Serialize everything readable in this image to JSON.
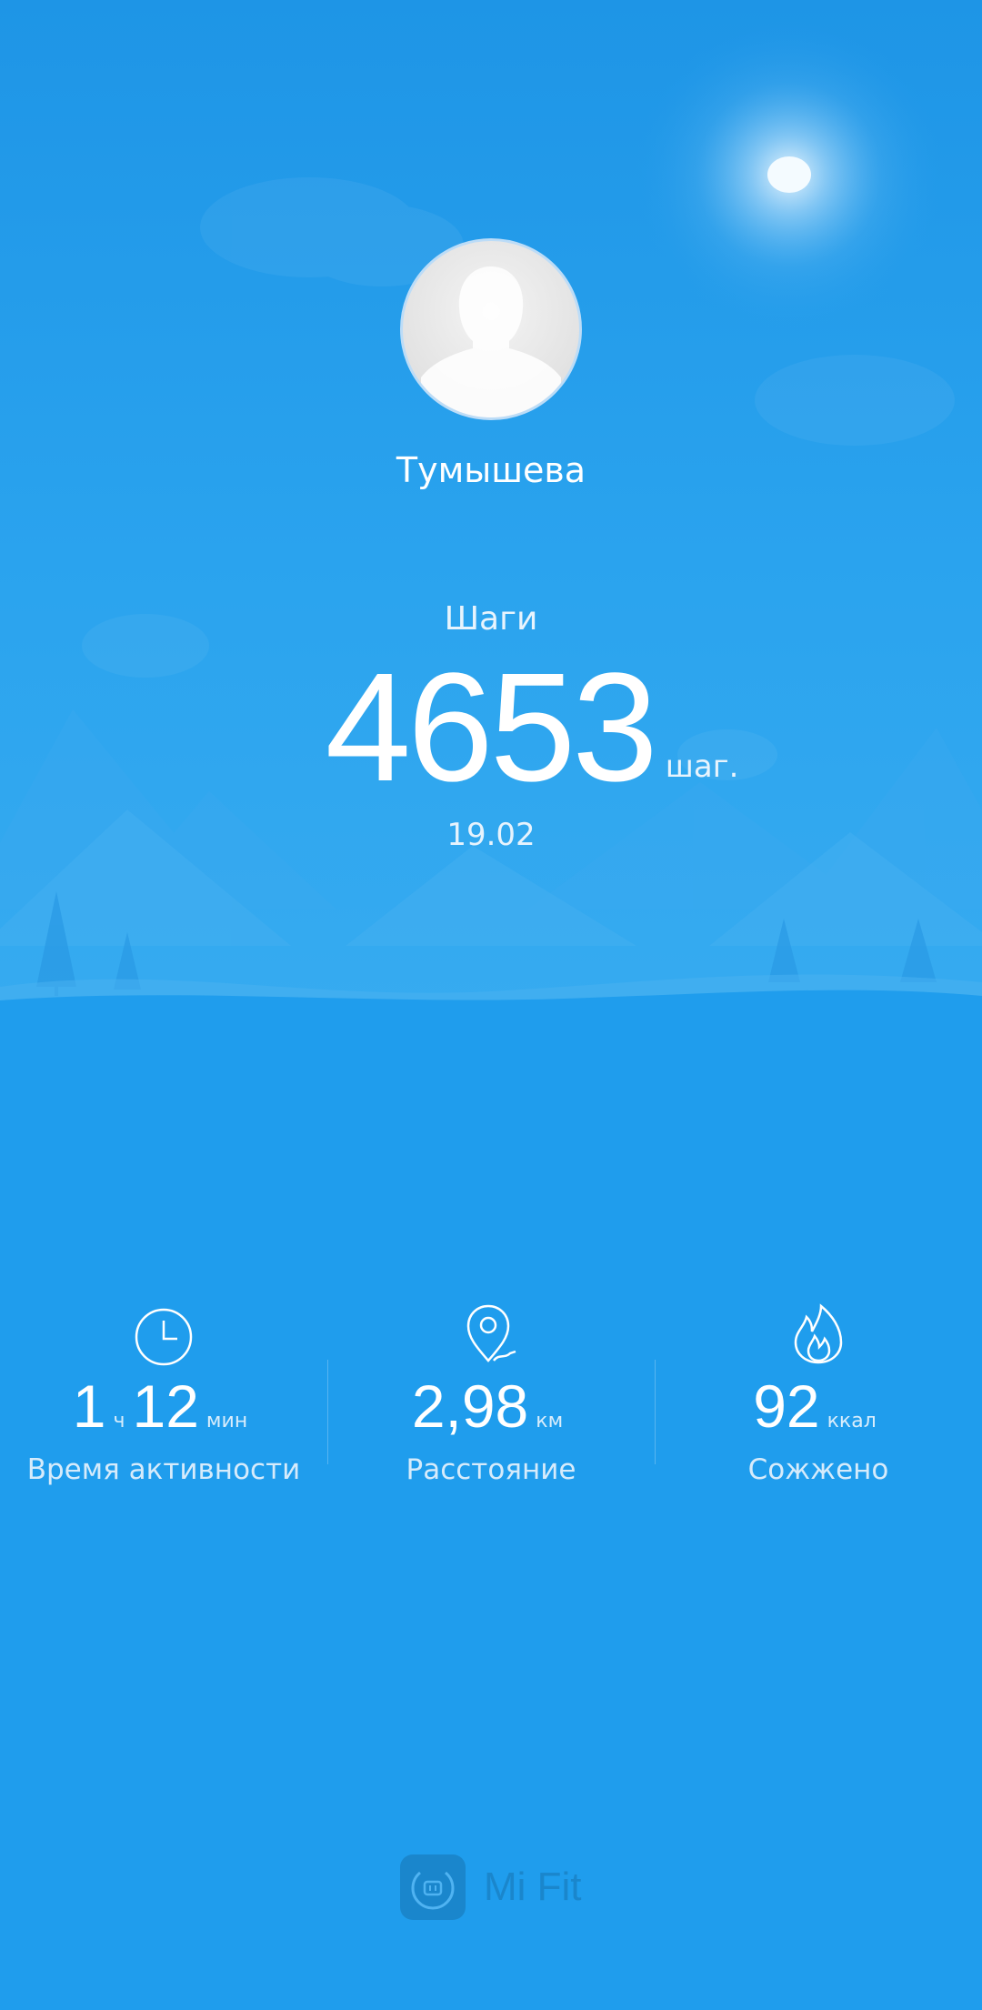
{
  "profile": {
    "name": "Тумышева"
  },
  "steps": {
    "label": "Шаги",
    "value": "4653",
    "unit": "шаг.",
    "date": "19.02"
  },
  "stats": [
    {
      "icon": "clock-icon",
      "value_hours": "1",
      "unit_hours": "ч",
      "value_minutes": "12",
      "unit_minutes": "мин",
      "caption": "Время активности"
    },
    {
      "icon": "location-pin-icon",
      "value": "2,98",
      "unit": "км",
      "caption": "Расстояние"
    },
    {
      "icon": "flame-icon",
      "value": "92",
      "unit": "ккал",
      "caption": "Сожжено"
    }
  ],
  "branding": {
    "logo_icon": "mi-logo-icon",
    "text": "Mi Fit"
  },
  "colors": {
    "background": "#1f9ded",
    "sky_top": "#1e95e6",
    "text": "#ffffff",
    "brand": "#1a86cc"
  }
}
